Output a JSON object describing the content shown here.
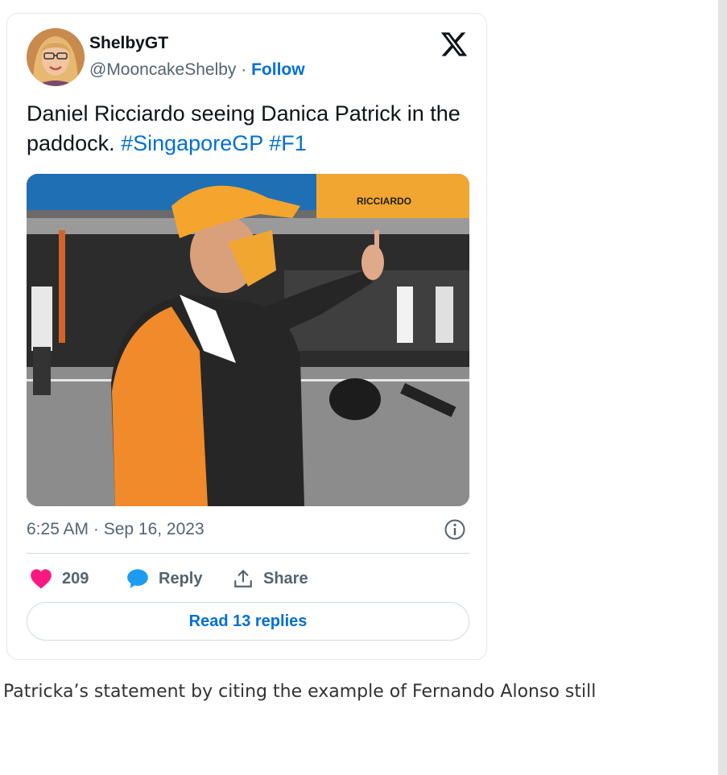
{
  "tweet": {
    "author_name": "ShelbyGT",
    "author_handle": "@MooncakeShelby",
    "separator": " · ",
    "follow_label": "Follow",
    "text_main": "Daniel Ricciardo seeing Danica Patrick in the paddock. ",
    "hashtags": [
      "#SingaporeGP",
      "#F1"
    ],
    "timestamp": "6:25 AM · Sep 16, 2023",
    "likes": "209",
    "reply_label": "Reply",
    "share_label": "Share",
    "read_replies_label": "Read 13 replies",
    "media_sign_text": "RICCIARDO",
    "icons": {
      "brand": "x-logo-icon",
      "like": "heart-icon",
      "reply": "speech-bubble-icon",
      "share": "share-upload-icon",
      "info": "info-icon"
    }
  },
  "article": {
    "text": "Patricka’s statement by citing the example of Fernando Alonso still"
  },
  "colors": {
    "link": "#006fd6",
    "like": "#f91880",
    "reply": "#1d9bf0",
    "secondary_text": "#536471",
    "border": "#cfd9de"
  }
}
